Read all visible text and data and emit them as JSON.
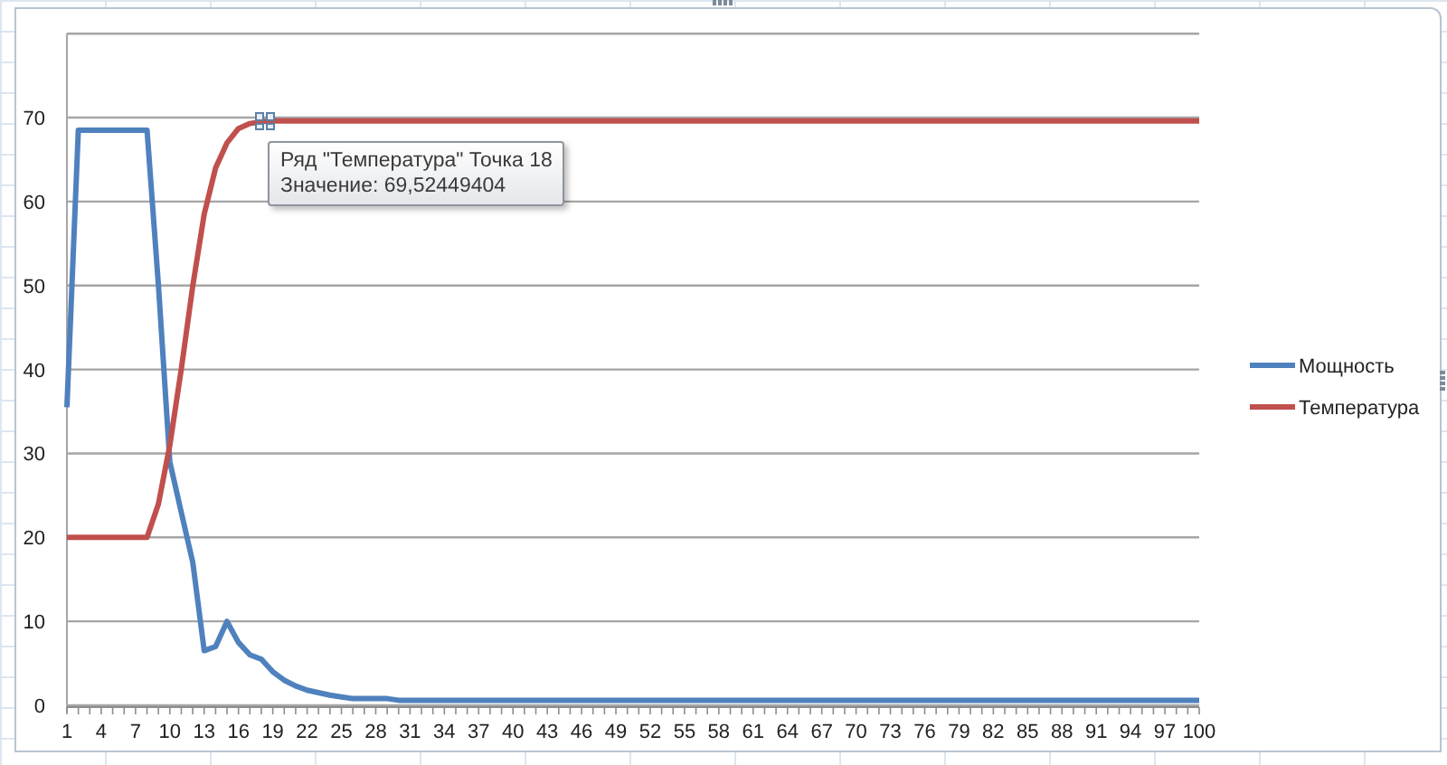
{
  "chart_data": {
    "type": "line",
    "x": [
      1,
      2,
      3,
      4,
      5,
      6,
      7,
      8,
      9,
      10,
      11,
      12,
      13,
      14,
      15,
      16,
      17,
      18,
      19,
      20,
      21,
      22,
      23,
      24,
      25,
      26,
      27,
      28,
      29,
      30,
      31,
      32,
      33,
      34,
      35,
      36,
      37,
      38,
      39,
      40,
      41,
      42,
      43,
      44,
      45,
      46,
      47,
      48,
      49,
      50,
      51,
      52,
      53,
      54,
      55,
      56,
      57,
      58,
      59,
      60,
      61,
      62,
      63,
      64,
      65,
      66,
      67,
      68,
      69,
      70,
      71,
      72,
      73,
      74,
      75,
      76,
      77,
      78,
      79,
      80,
      81,
      82,
      83,
      84,
      85,
      86,
      87,
      88,
      89,
      90,
      91,
      92,
      93,
      94,
      95,
      96,
      97,
      98,
      99,
      100
    ],
    "series": [
      {
        "name": "Мощность",
        "color": "#4f81bd",
        "values": [
          35.5,
          68.5,
          68.5,
          68.5,
          68.5,
          68.5,
          68.5,
          68.5,
          50,
          29,
          23,
          17,
          6.5,
          7,
          10,
          7.5,
          6,
          5.5,
          4,
          3,
          2.3,
          1.8,
          1.5,
          1.2,
          1,
          0.8,
          0.8,
          0.8,
          0.8,
          0.6,
          0.6,
          0.6,
          0.6,
          0.6,
          0.6,
          0.6,
          0.6,
          0.6,
          0.6,
          0.6,
          0.6,
          0.6,
          0.6,
          0.6,
          0.6,
          0.6,
          0.6,
          0.6,
          0.6,
          0.6,
          0.6,
          0.6,
          0.6,
          0.6,
          0.6,
          0.6,
          0.6,
          0.6,
          0.6,
          0.6,
          0.6,
          0.6,
          0.6,
          0.6,
          0.6,
          0.6,
          0.6,
          0.6,
          0.6,
          0.6,
          0.6,
          0.6,
          0.6,
          0.6,
          0.6,
          0.6,
          0.6,
          0.6,
          0.6,
          0.6,
          0.6,
          0.6,
          0.6,
          0.6,
          0.6,
          0.6,
          0.6,
          0.6,
          0.6,
          0.6,
          0.6,
          0.6,
          0.6,
          0.6,
          0.6,
          0.6,
          0.6,
          0.6,
          0.6,
          0.6
        ]
      },
      {
        "name": "Температура",
        "color": "#c0504d",
        "values": [
          20,
          20,
          20,
          20,
          20,
          20,
          20,
          20,
          24,
          31,
          40,
          50,
          58.5,
          64,
          67,
          68.7,
          69.3,
          69.5,
          69.6,
          69.6,
          69.6,
          69.6,
          69.6,
          69.6,
          69.6,
          69.6,
          69.6,
          69.6,
          69.6,
          69.6,
          69.6,
          69.6,
          69.6,
          69.6,
          69.6,
          69.6,
          69.6,
          69.6,
          69.6,
          69.6,
          69.6,
          69.6,
          69.6,
          69.6,
          69.6,
          69.6,
          69.6,
          69.6,
          69.6,
          69.6,
          69.6,
          69.6,
          69.6,
          69.6,
          69.6,
          69.6,
          69.6,
          69.6,
          69.6,
          69.6,
          69.6,
          69.6,
          69.6,
          69.6,
          69.6,
          69.6,
          69.6,
          69.6,
          69.6,
          69.6,
          69.6,
          69.6,
          69.6,
          69.6,
          69.6,
          69.6,
          69.6,
          69.6,
          69.6,
          69.6,
          69.6,
          69.6,
          69.6,
          69.6,
          69.6,
          69.6,
          69.6,
          69.6,
          69.6,
          69.6,
          69.6,
          69.6,
          69.6,
          69.6,
          69.6,
          69.6,
          69.6,
          69.6,
          69.6,
          69.6
        ]
      }
    ],
    "xlim": [
      1,
      100
    ],
    "ylim": [
      0,
      80
    ],
    "yticks": [
      0,
      10,
      20,
      30,
      40,
      50,
      60,
      70
    ],
    "xticks": [
      1,
      4,
      7,
      10,
      13,
      16,
      19,
      22,
      25,
      28,
      31,
      34,
      37,
      40,
      43,
      46,
      49,
      52,
      55,
      58,
      61,
      64,
      67,
      70,
      73,
      76,
      79,
      82,
      85,
      88,
      91,
      94,
      97,
      100
    ],
    "grid": true,
    "legend": true
  },
  "tooltip": {
    "title": "Ряд \"Температура\" Точка 18",
    "value": "Значение: 69,52449404"
  }
}
